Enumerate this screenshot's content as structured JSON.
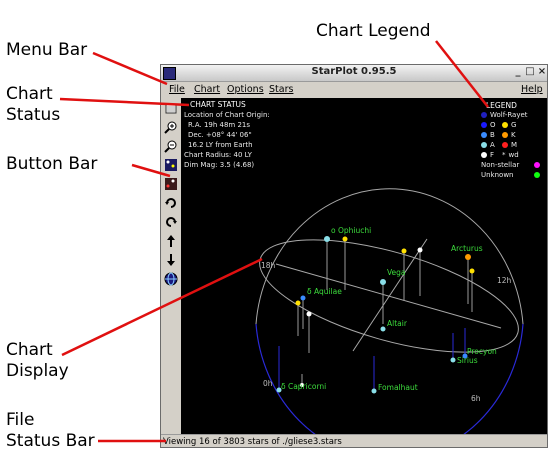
{
  "callouts": {
    "menu_bar": "Menu Bar",
    "chart_status_line1": "Chart",
    "chart_status_line2": "Status",
    "button_bar": "Button Bar",
    "chart_display_line1": "Chart",
    "chart_display_line2": "Display",
    "file_status_line1": "File",
    "file_status_line2": "Status Bar",
    "chart_legend": "Chart Legend"
  },
  "window": {
    "title": "StarPlot 0.95.5",
    "controls": [
      "_",
      "□",
      "×"
    ]
  },
  "menu": {
    "file": "File",
    "chart": "Chart",
    "options": "Options",
    "stars": "Stars",
    "help": "Help"
  },
  "toolbar_icons": [
    "open-file-icon",
    "zoom-in-icon",
    "zoom-out-icon",
    "chart-view-icon",
    "stars-view-icon",
    "rotate-cw-icon",
    "rotate-ccw-icon",
    "arrow-up-icon",
    "arrow-down-icon",
    "globe-icon"
  ],
  "chart_status": {
    "title": "CHART STATUS",
    "lines": [
      "Location of Chart Origin:",
      "R.A. 19h 48m 21s",
      "Dec. +08° 44' 06\"",
      "16.2 LY from Earth",
      "Chart Radius: 40 LY",
      "Dim Mag: 3.5 (4.68)"
    ]
  },
  "legend": {
    "title": "LEGEND",
    "wolf_rayet": "Wolf-Rayet",
    "classes": [
      "O",
      "G",
      "B",
      "K",
      "A",
      "M",
      "F",
      "wd"
    ],
    "wd_symbol": "*",
    "non_stellar": "Non-stellar",
    "unknown": "Unknown",
    "colors": {
      "wolf_rayet": "#2020c0",
      "O": "#1a1aff",
      "G": "#ffe000",
      "B": "#3a8cff",
      "K": "#ff9a00",
      "A": "#8adfe8",
      "M": "#ff2020",
      "F": "#ffffff",
      "non_stellar": "#ff10ff",
      "unknown": "#10ff10"
    }
  },
  "stars": {
    "omicron_ophiuchi": "ο Ophiuchi",
    "arcturus": "Arcturus",
    "vega": "Vega",
    "delta_aquilae": "δ Aquilae",
    "altair": "Altair",
    "procyon": "Procyon",
    "sirius": "Sirius",
    "delta_capricorni": "δ Capricorni",
    "fomalhaut": "Fomalhaut"
  },
  "grid_labels": {
    "h18": "18h",
    "h12": "12h",
    "h0": "0h",
    "h6": "6h"
  },
  "file_status": "Viewing 16 of 3803 stars of ./gliese3.stars"
}
